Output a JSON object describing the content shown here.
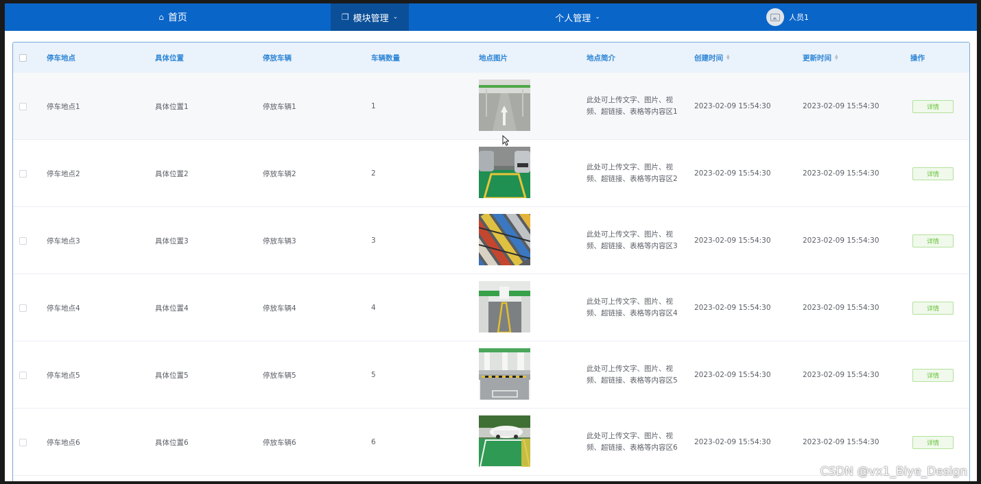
{
  "nav": {
    "home_label": "首页",
    "module_label": "模块管理",
    "personal_label": "个人管理",
    "user_label": "人员1"
  },
  "table": {
    "headers": [
      "停车地点",
      "具体位置",
      "停放车辆",
      "车辆数量",
      "地点图片",
      "地点简介",
      "创建时间",
      "更新时间",
      "操作"
    ],
    "action_label": "详情",
    "rows": [
      {
        "place": "停车地点1",
        "position": "具体位置1",
        "vehicle": "停放车辆1",
        "count": "1",
        "intro_line1": "此处可上传文字、图片、视",
        "intro_line2": "频、超链接、表格等内容区1",
        "created": "2023-02-09 15:54:30",
        "updated": "2023-02-09 15:54:30",
        "image": "garage-arrow"
      },
      {
        "place": "停车地点2",
        "position": "具体位置2",
        "vehicle": "停放车辆2",
        "count": "2",
        "intro_line1": "此处可上传文字、图片、视",
        "intro_line2": "频、超链接、表格等内容区2",
        "created": "2023-02-09 15:54:30",
        "updated": "2023-02-09 15:54:30",
        "image": "green-bay-cars"
      },
      {
        "place": "停车地点3",
        "position": "具体位置3",
        "vehicle": "停放车辆3",
        "count": "3",
        "intro_line1": "此处可上传文字、图片、视",
        "intro_line2": "频、超链接、表格等内容区3",
        "created": "2023-02-09 15:54:30",
        "updated": "2023-02-09 15:54:30",
        "image": "aerial-lot"
      },
      {
        "place": "停车地点4",
        "position": "具体位置4",
        "vehicle": "停放车辆4",
        "count": "4",
        "intro_line1": "此处可上传文字、图片、视",
        "intro_line2": "频、超链接、表格等内容区4",
        "created": "2023-02-09 15:54:30",
        "updated": "2023-02-09 15:54:30",
        "image": "garage-yellow"
      },
      {
        "place": "停车地点5",
        "position": "具体位置5",
        "vehicle": "停放车辆5",
        "count": "5",
        "intro_line1": "此处可上传文字、图片、视",
        "intro_line2": "频、超链接、表格等内容区5",
        "created": "2023-02-09 15:54:30",
        "updated": "2023-02-09 15:54:30",
        "image": "garage-numbered"
      },
      {
        "place": "停车地点6",
        "position": "具体位置6",
        "vehicle": "停放车辆6",
        "count": "6",
        "intro_line1": "此处可上传文字、图片、视",
        "intro_line2": "频、超链接、表格等内容区6",
        "created": "2023-02-09 15:54:30",
        "updated": "2023-02-09 15:54:30",
        "image": "outdoor-green-bay"
      }
    ]
  },
  "watermark": "CSDN @vx1_Biye_Design",
  "colors": {
    "nav": "#0a65c8",
    "nav_active": "#0b4f99",
    "header_text": "#2f86d6",
    "detail_green": "#67c23a"
  }
}
